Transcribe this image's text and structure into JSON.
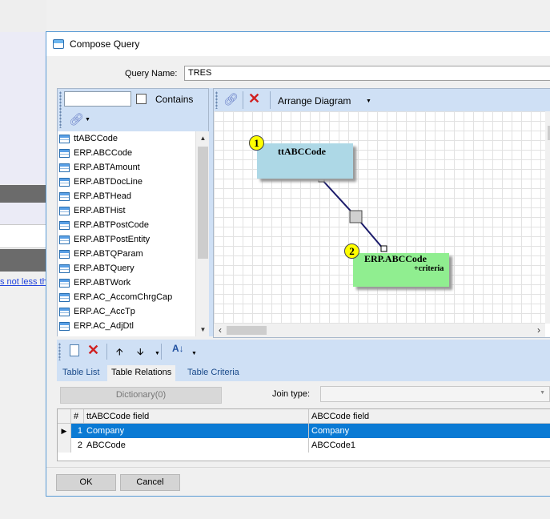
{
  "background": {
    "link_text": "s not less th"
  },
  "dialog": {
    "title": "Compose Query",
    "query_name_label": "Query Name:",
    "query_name_value": "TRES"
  },
  "left_panel": {
    "search_value": "",
    "contains_label": "Contains",
    "contains_checked": false,
    "tables": [
      "ttABCCode",
      "ERP.ABCCode",
      "ERP.ABTAmount",
      "ERP.ABTDocLine",
      "ERP.ABTHead",
      "ERP.ABTHist",
      "ERP.ABTPostCode",
      "ERP.ABTPostEntity",
      "ERP.ABTQParam",
      "ERP.ABTQuery",
      "ERP.ABTWork",
      "ERP.AC_AccomChrgCap",
      "ERP.AC_AccTp",
      "ERP.AC_AdjDtl"
    ]
  },
  "diagram": {
    "arrange_label": "Arrange Diagram",
    "nodes": [
      {
        "badge": "1",
        "name": "ttABCCode",
        "sub": "",
        "color": "#add8e6"
      },
      {
        "badge": "2",
        "name": "ERP.ABCCode",
        "sub": "+criteria",
        "color": "#90ee90"
      }
    ]
  },
  "bottom": {
    "tabs": [
      "Table List",
      "Table Relations",
      "Table Criteria"
    ],
    "active_tab": "Table Relations",
    "dictionary_label": "Dictionary(0)",
    "join_type_label": "Join type:",
    "join_type_value": "",
    "grid": {
      "headers": [
        "#",
        "ttABCCode field",
        "ABCCode field"
      ],
      "rows": [
        {
          "num": "1",
          "left": "Company",
          "right": "Company",
          "selected": true
        },
        {
          "num": "2",
          "left": "ABCCode",
          "right": "ABCCode1",
          "selected": false
        }
      ]
    }
  },
  "buttons": {
    "ok": "OK",
    "cancel": "Cancel"
  }
}
